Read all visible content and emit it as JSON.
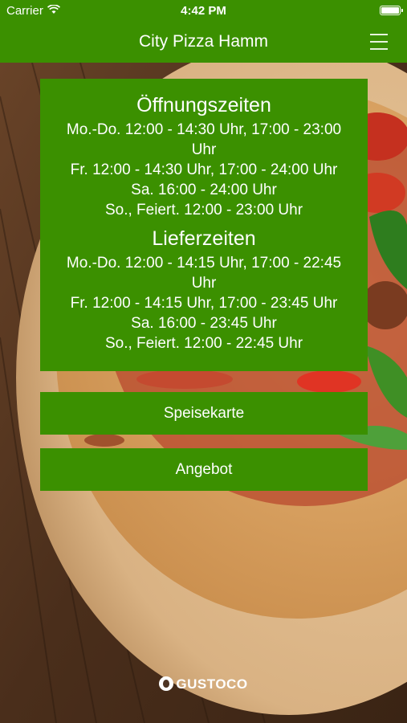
{
  "status_bar": {
    "carrier": "Carrier",
    "time": "4:42 PM"
  },
  "nav": {
    "title": "City Pizza Hamm",
    "menu_icon": "hamburger-menu-icon"
  },
  "opening_hours": {
    "heading": "Öffnungszeiten",
    "lines": [
      "Mo.-Do. 12:00 - 14:30 Uhr, 17:00 - 23:00 Uhr",
      "Fr. 12:00 - 14:30 Uhr, 17:00 - 24:00 Uhr",
      "Sa. 16:00 - 24:00 Uhr",
      "So., Feiert. 12:00 - 23:00 Uhr"
    ]
  },
  "delivery_hours": {
    "heading": "Lieferzeiten",
    "lines": [
      "Mo.-Do. 12:00 - 14:15 Uhr, 17:00 - 22:45 Uhr",
      "Fr. 12:00 - 14:15 Uhr, 17:00 - 23:45 Uhr",
      "Sa. 16:00 - 23:45 Uhr",
      "So., Feiert. 12:00 - 22:45 Uhr"
    ]
  },
  "buttons": {
    "menu_label": "Speisekarte",
    "offer_label": "Angebot"
  },
  "footer": {
    "brand": "GUSTOCO"
  },
  "colors": {
    "primary_green": "#3b9000",
    "text": "#ffffff"
  }
}
